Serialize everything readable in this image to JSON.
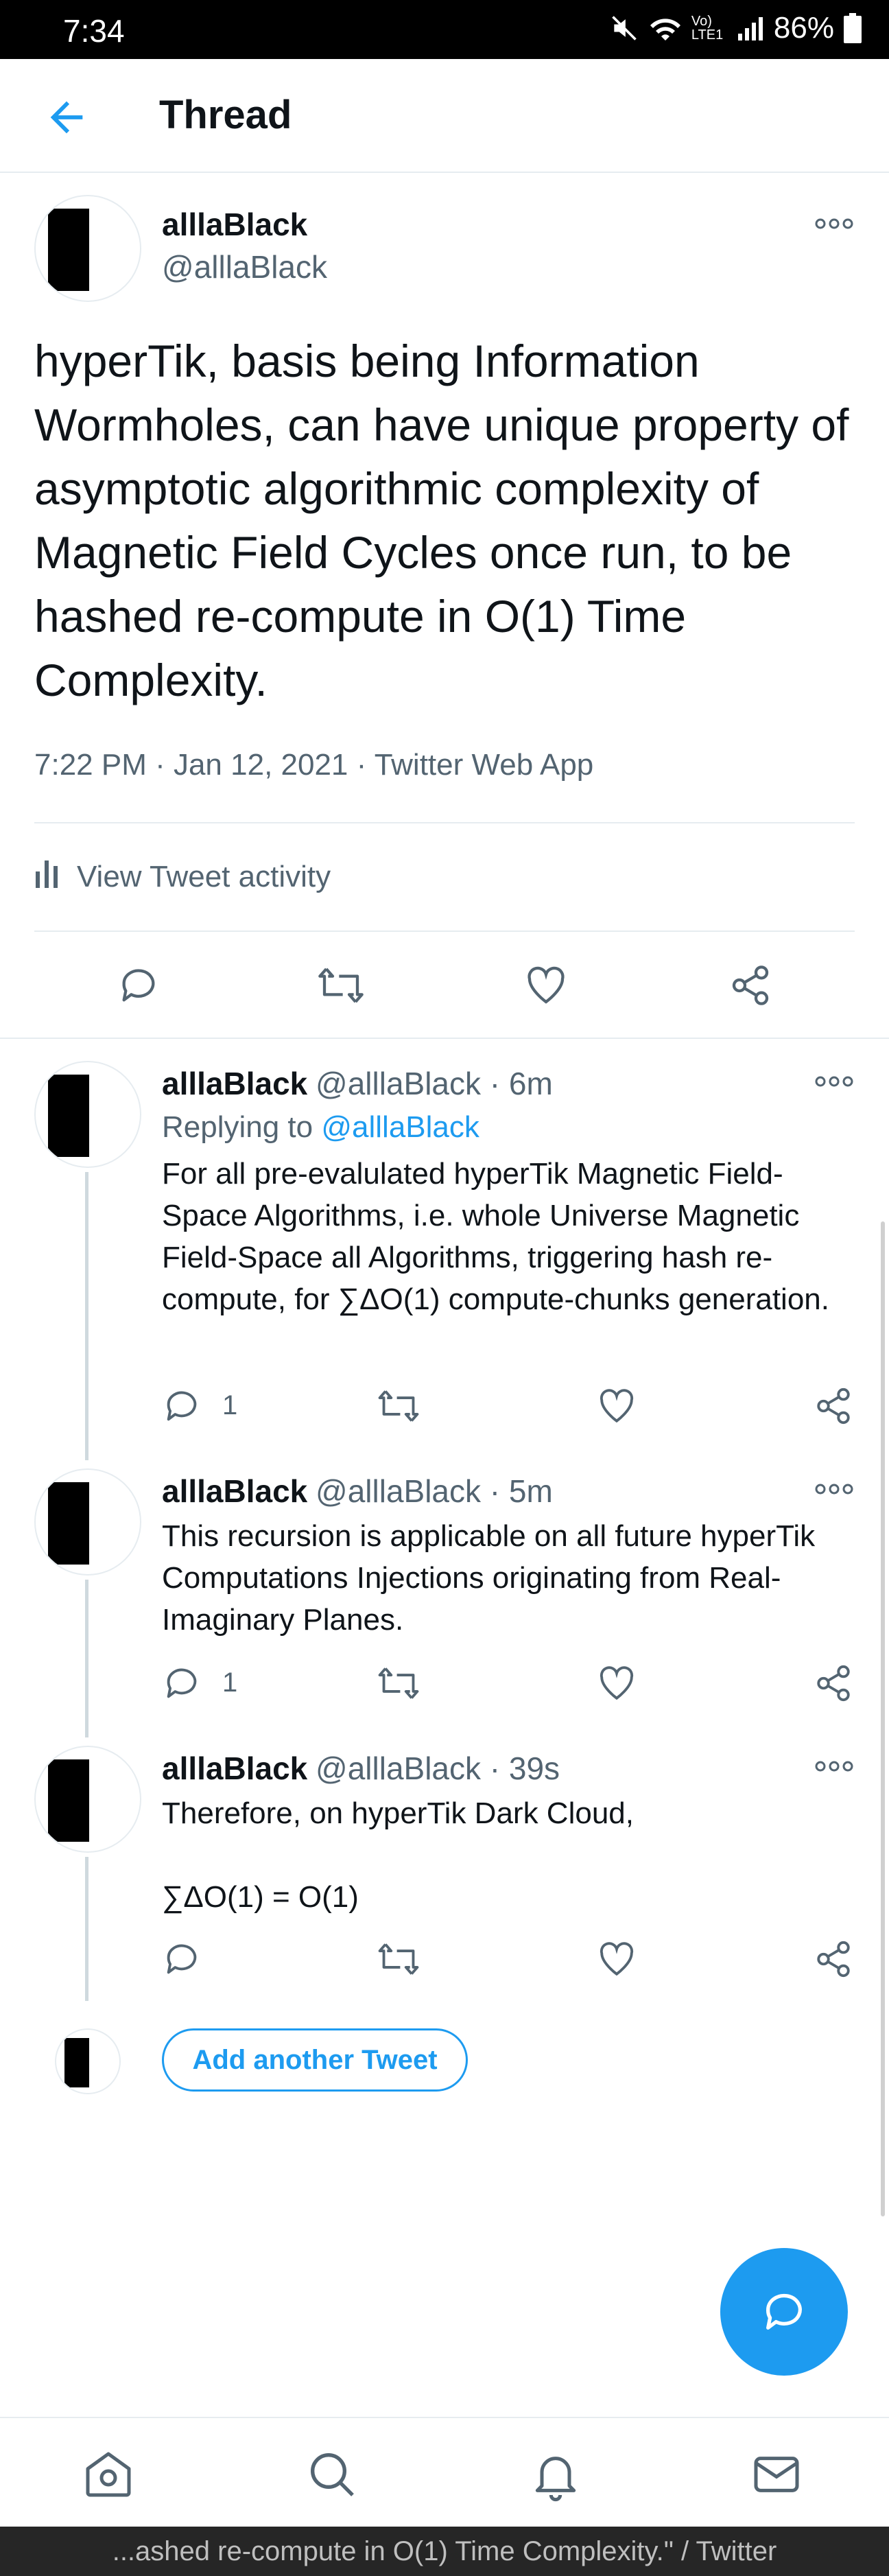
{
  "status_bar": {
    "time": "7:34",
    "network": "Vo) LTE1",
    "battery": "86%"
  },
  "header": {
    "title": "Thread"
  },
  "main_tweet": {
    "name": "alllaBlack",
    "handle": "@alllaBlack",
    "text": "hyperTik, basis being Information Wormholes, can have unique property of asymptotic algorithmic complexity of Magnetic Field Cycles once run, to be hashed re-compute in O(1) Time Complexity.",
    "meta": "7:22 PM · Jan 12, 2021 · Twitter Web App",
    "activity_label": "View Tweet activity"
  },
  "replies": [
    {
      "name": "alllaBlack",
      "handle": "@alllaBlack · 6m",
      "replying_prefix": "Replying to ",
      "replying_to": "@alllaBlack",
      "text": "For all pre-evalulated hyperTik Magnetic Field-Space Algorithms, i.e. whole Universe Magnetic Field-Space all Algorithms, triggering hash re-compute, for ∑ΔO(1) compute-chunks generation.",
      "reply_count": "1"
    },
    {
      "name": "alllaBlack",
      "handle": "@alllaBlack · 5m",
      "text": "This recursion is applicable on all future hyperTik Computations Injections originating from Real-Imaginary Planes.",
      "reply_count": "1"
    },
    {
      "name": "alllaBlack",
      "handle": "@alllaBlack · 39s",
      "text_line1": "Therefore, on hyperTik Dark Cloud,",
      "text_line2": "∑ΔO(1) = O(1)"
    }
  ],
  "add_tweet_label": "Add another Tweet",
  "url_bar": "...ashed re-compute in O(1) Time Complexity.\" / Twitter",
  "colors": {
    "accent": "#1d9bf0",
    "secondary_text": "#536471",
    "divider": "#e6ecf0"
  }
}
